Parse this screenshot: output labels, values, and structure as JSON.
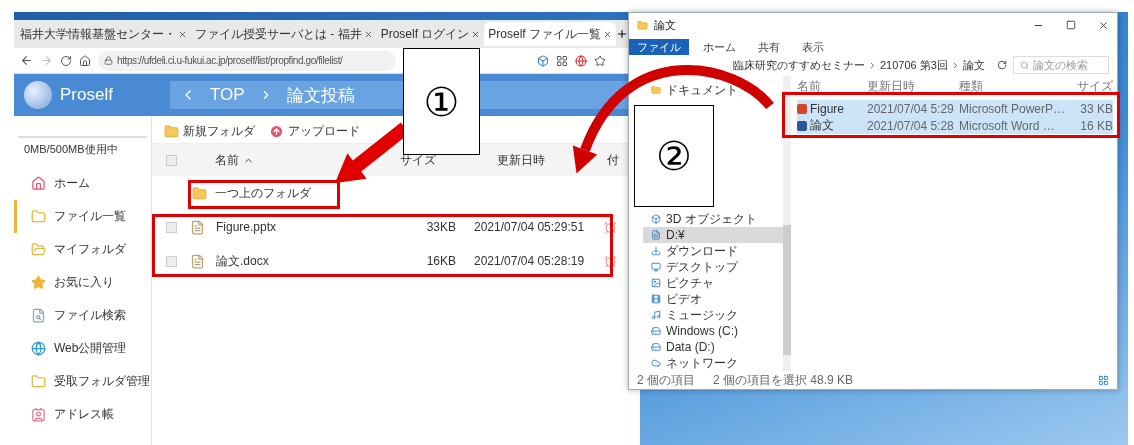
{
  "browser": {
    "tabs": [
      {
        "title": "福井大学情報基盤センター・",
        "selected": false
      },
      {
        "title": "ファイル授受サーバとは - 福井",
        "selected": false
      },
      {
        "title": "Proself ログイン",
        "selected": false
      },
      {
        "title": "Proself ファイル一覧",
        "selected": true
      }
    ],
    "url": "https://ufdeli.ci.u-fukui.ac.jp/proself/list/propfind.go/filelist/"
  },
  "app": {
    "logo": "Proself",
    "breadcrumb": [
      "TOP",
      "論文投稿"
    ],
    "usage": "0MB/500MB使用中",
    "sidebar": {
      "items": [
        {
          "label": "ホーム",
          "selected": false
        },
        {
          "label": "ファイル一覧",
          "selected": true
        },
        {
          "label": "マイフォルダ",
          "selected": false
        },
        {
          "label": "お気に入り",
          "selected": false
        },
        {
          "label": "ファイル検索",
          "selected": false
        },
        {
          "label": "Web公開管理",
          "selected": false
        },
        {
          "label": "受取フォルダ管理",
          "selected": false
        },
        {
          "label": "アドレス帳",
          "selected": false
        }
      ]
    },
    "toolbar": [
      "新規フォルダ",
      "アップロード"
    ],
    "table": {
      "select_all": {
        "checked": false
      },
      "columns": [
        "名前",
        "サイズ",
        "更新日時",
        "付"
      ],
      "parent_folder": "一つ上のフォルダ",
      "rows": [
        {
          "name": "Figure.pptx",
          "size": "33KB",
          "modified": "2021/07/04 05:29:51",
          "checked": false
        },
        {
          "name": "論文.docx",
          "size": "16KB",
          "modified": "2021/07/04 05:28:19",
          "checked": false
        }
      ]
    }
  },
  "explorer": {
    "title": "論文",
    "ribbon_tabs": [
      {
        "label": "ファイル",
        "selected": true
      },
      {
        "label": "ホーム",
        "selected": false
      },
      {
        "label": "共有",
        "selected": false
      },
      {
        "label": "表示",
        "selected": false
      }
    ],
    "path": [
      "臨床研究のすすめセミナー",
      "210706 第3回",
      "論文"
    ],
    "search": {
      "placeholder": "論文の検索"
    },
    "nav_top": [
      {
        "label": "ドキュメント",
        "selected": false
      }
    ],
    "nav": [
      {
        "label": "3D オブジェクト",
        "selected": false
      },
      {
        "label": "D:¥",
        "selected": true
      },
      {
        "label": "ダウンロード",
        "selected": false
      },
      {
        "label": "デスクトップ",
        "selected": false
      },
      {
        "label": "ピクチャ",
        "selected": false
      },
      {
        "label": "ビデオ",
        "selected": false
      },
      {
        "label": "ミュージック",
        "selected": false
      },
      {
        "label": "Windows (C:)",
        "selected": false
      },
      {
        "label": "Data (D:)",
        "selected": false
      },
      {
        "label": "ネットワーク",
        "selected": false
      }
    ],
    "columns": [
      "名前",
      "更新日時",
      "種類",
      "サイズ"
    ],
    "rows": [
      {
        "kind": "powerpoint",
        "name": "Figure",
        "modified": "2021/07/04 5:29",
        "type": "Microsoft PowerP…",
        "size": "33 KB",
        "selected": true
      },
      {
        "kind": "word",
        "name": "論文",
        "modified": "2021/07/04 5:28",
        "type": "Microsoft Word …",
        "size": "16 KB",
        "selected": true
      }
    ],
    "status": [
      "2 個の項目",
      "2 個の項目を選択 48.9 KB"
    ]
  },
  "annotations": [
    "①",
    "②"
  ]
}
